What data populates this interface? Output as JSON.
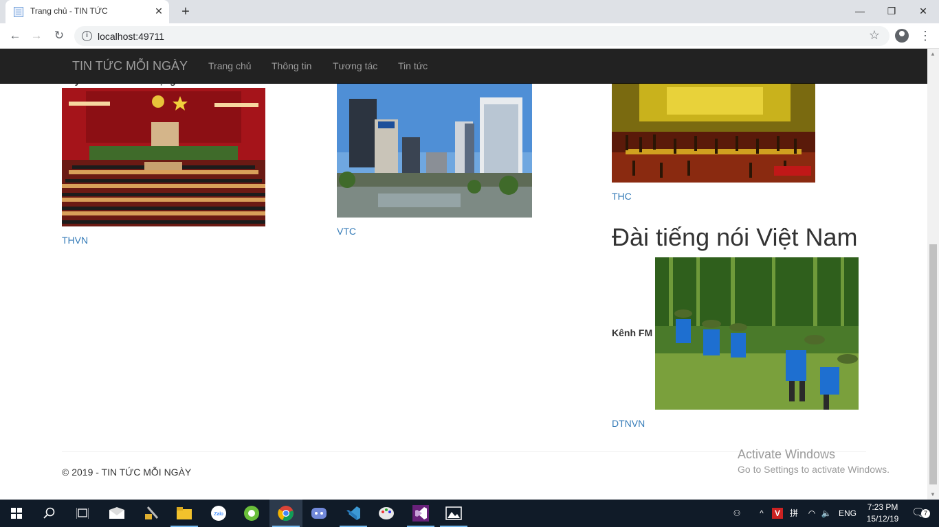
{
  "browser": {
    "tab_title": "Trang chủ - TIN TỨC",
    "url": "localhost:49711"
  },
  "site": {
    "brand": "TIN TỨC MỖI NGÀY",
    "nav": [
      "Trang chủ",
      "Thông tin",
      "Tương tác",
      "Tin tức"
    ],
    "cut_heading": "truyền hình và báo mạng online.",
    "columns": [
      {
        "link": "THVN"
      },
      {
        "link": "VTC"
      },
      {
        "link": "THC"
      }
    ],
    "radio_heading": "Đài tiếng nói Việt Nam",
    "fm_label": "Kênh FM",
    "radio_link": "DTNVN",
    "footer": "© 2019 - TIN TỨC MỖI NGÀY"
  },
  "watermark": {
    "title": "Activate Windows",
    "subtitle": "Go to Settings to activate Windows."
  },
  "taskbar": {
    "lang": "ENG",
    "time": "7:23 PM",
    "date": "15/12/19",
    "notif_count": "7",
    "icons": [
      "start-icon",
      "search-icon",
      "task-view-icon",
      "mail-icon",
      "tools-icon",
      "file-explorer-icon",
      "zalo-icon",
      "coccoc-icon",
      "chrome-icon",
      "discord-icon",
      "visual-studio-code-icon",
      "paint-icon",
      "visual-studio-icon",
      "photos-icon"
    ]
  }
}
